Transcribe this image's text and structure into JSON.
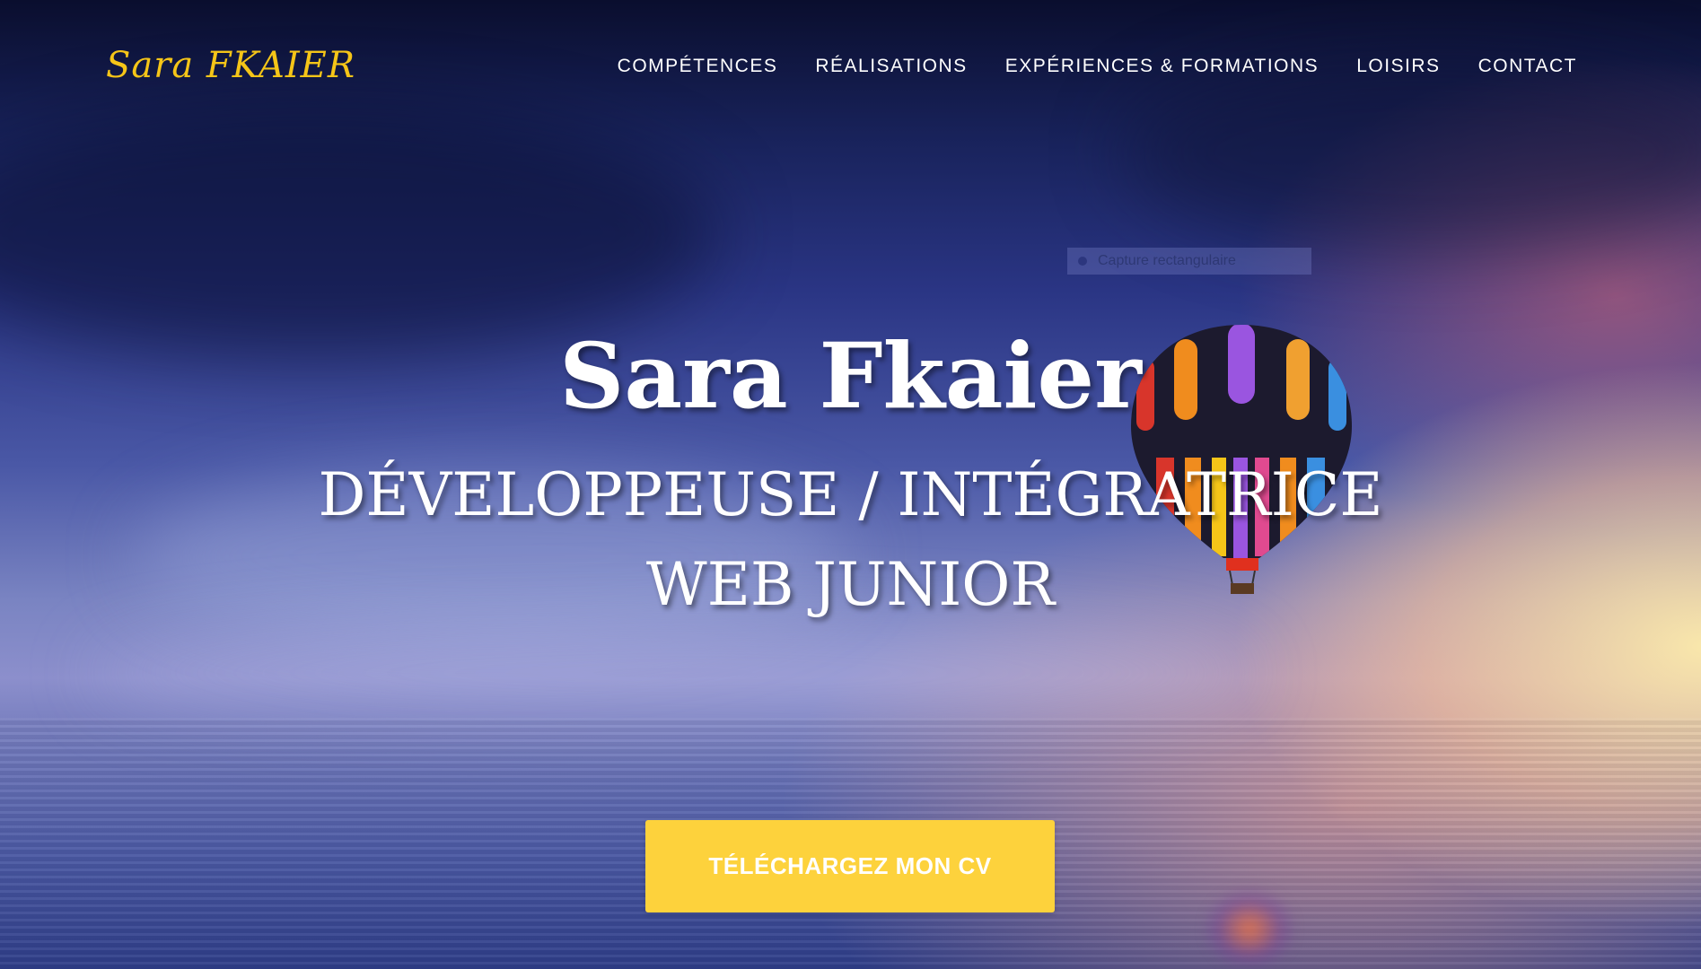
{
  "brand": {
    "logo": "Sara FKAIER"
  },
  "nav": {
    "items": [
      {
        "label": "COMPÉTENCES"
      },
      {
        "label": "RÉALISATIONS"
      },
      {
        "label": "EXPÉRIENCES & FORMATIONS"
      },
      {
        "label": "LOISIRS"
      },
      {
        "label": "CONTACT"
      }
    ]
  },
  "hero": {
    "name": "Sara Fkaier",
    "subtitle_line1": "DÉVELOPPEUSE / INTÉGRATRICE",
    "subtitle_line2": "WEB JUNIOR",
    "cta_label": "TÉLÉCHARGEZ MON CV"
  },
  "overlay": {
    "snip_label": "Capture rectangulaire"
  },
  "colors": {
    "accent": "#fdd23c",
    "logo": "#f5c518",
    "text": "#ffffff"
  }
}
